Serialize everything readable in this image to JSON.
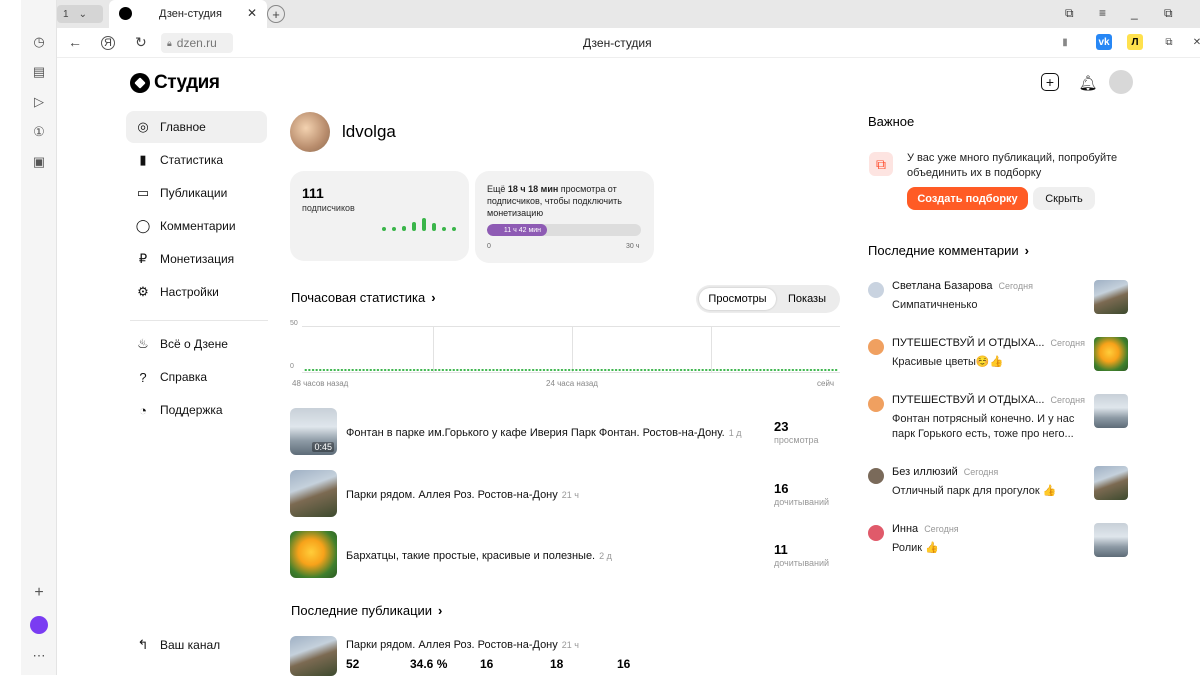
{
  "browser": {
    "tab_counter": "1",
    "tab_title": "Дзен-студия",
    "url": "dzen.ru",
    "page_title": "Дзен-студия"
  },
  "studio": {
    "logo": "Студия",
    "nav": [
      {
        "label": "Главное",
        "icon": "planet-icon"
      },
      {
        "label": "Статистика",
        "icon": "stats-icon"
      },
      {
        "label": "Публикации",
        "icon": "publications-icon"
      },
      {
        "label": "Комментарии",
        "icon": "comment-icon"
      },
      {
        "label": "Монетизация",
        "icon": "ruble-icon"
      },
      {
        "label": "Настройки",
        "icon": "gear-icon"
      }
    ],
    "nav_secondary": [
      {
        "label": "Всё о Дзене",
        "icon": "flame-icon"
      },
      {
        "label": "Справка",
        "icon": "help-icon"
      },
      {
        "label": "Поддержка",
        "icon": "support-icon"
      }
    ],
    "your_channel": "Ваш канал"
  },
  "profile": {
    "name": "ldvolga",
    "subscribers_count": "111",
    "subscribers_label": "подписчиков"
  },
  "monetization": {
    "text_pre": "Ещё ",
    "text_bold": "18 ч 18 мин",
    "text_post": " просмотра от подписчиков, чтобы подключить монетизацию",
    "progress_label": "11 ч 42 мин",
    "progress_fraction": 0.39,
    "min": "0",
    "max": "30 ч"
  },
  "hourly": {
    "title": "Почасовая статистика",
    "tabs": [
      "Просмотры",
      "Показы"
    ],
    "active_tab": 0,
    "y_max": "50",
    "y_min": "0",
    "x_labels": [
      "48 часов назад",
      "24 часа назад",
      "сейч"
    ]
  },
  "chart_data": {
    "type": "bar",
    "title": "Почасовая статистика",
    "ylim": [
      0,
      50
    ],
    "values": [
      1,
      1,
      1,
      1,
      1,
      1,
      1,
      1,
      1,
      1,
      1,
      1,
      1,
      1,
      1,
      1,
      1,
      1,
      1,
      1,
      1,
      1,
      1,
      1,
      1,
      1,
      1,
      1,
      1,
      1,
      1,
      1,
      1,
      1,
      1,
      1,
      1,
      1,
      1,
      1,
      1,
      1,
      1,
      1,
      1,
      1,
      1,
      1,
      1,
      1,
      1,
      1,
      1,
      1,
      1,
      1,
      1,
      1,
      1,
      1,
      1,
      1,
      1,
      1,
      1,
      1,
      1,
      1,
      1,
      1,
      1,
      1,
      1,
      1,
      1,
      1,
      1,
      1,
      1,
      1,
      1,
      1,
      1,
      1,
      1,
      1,
      1,
      1,
      1,
      1,
      1,
      1,
      1,
      1,
      1,
      1,
      1,
      1,
      1,
      1,
      1,
      1,
      1,
      1,
      1,
      1,
      1,
      1,
      1,
      1,
      1,
      1,
      1,
      1,
      1,
      1,
      1,
      1,
      1,
      1,
      1,
      1,
      1,
      1,
      1,
      1,
      1,
      1,
      1,
      1,
      1,
      1,
      1,
      1,
      1,
      1,
      1,
      1,
      1,
      1,
      1,
      1,
      1,
      1,
      1,
      1,
      1,
      1
    ]
  },
  "publications": [
    {
      "title": "Фонтан в парке им.Горького у кафе Иверия Парк Фонтан. Ростов-на-Дону.",
      "age": "1 д",
      "value": "23",
      "label": "просмотра",
      "duration": "0:45",
      "thumb": "fountain"
    },
    {
      "title": "Парки рядом. Аллея Роз. Ростов-на-Дону",
      "age": "21 ч",
      "value": "16",
      "label": "дочитываний",
      "duration": "",
      "thumb": "statue"
    },
    {
      "title": "Бархатцы, такие простые, красивые и полезные.",
      "age": "2 д",
      "value": "11",
      "label": "дочитываний",
      "duration": "",
      "thumb": "flower"
    }
  ],
  "latest": {
    "title": "Последние публикации",
    "item_title": "Парки рядом. Аллея Роз. Ростов-на-Дону",
    "item_age": "21 ч",
    "stats": [
      "52",
      "34.6 %",
      "16",
      "18",
      "16"
    ]
  },
  "important": {
    "title": "Важное",
    "text": "У вас уже много публикаций, попробуйте объединить их в подборку",
    "primary": "Создать подборку",
    "secondary": "Скрыть"
  },
  "comments": {
    "title": "Последние комментарии",
    "items": [
      {
        "author": "Светлана Базарова",
        "time": "Сегодня",
        "text": "Симпатичненько",
        "thumb": "statue"
      },
      {
        "author": "ПУТЕШЕСТВУЙ И ОТДЫХА...",
        "time": "Сегодня",
        "text": "Красивые цветы☺️👍",
        "thumb": "flower"
      },
      {
        "author": "ПУТЕШЕСТВУЙ И ОТДЫХА...",
        "time": "Сегодня",
        "text": "Фонтан потрясный конечно. И у нас парк Горького есть, тоже про него...",
        "thumb": "fountain"
      },
      {
        "author": "Без иллюзий",
        "time": "Сегодня",
        "text": "Отличный парк для прогулок 👍",
        "thumb": "statue"
      },
      {
        "author": "Инна",
        "time": "Сегодня",
        "text": "Ролик 👍",
        "thumb": "fountain"
      }
    ]
  },
  "colors": {
    "accent": "#ff5b25",
    "chart_green": "#3ab54a",
    "progress_purple": "#8e5bb4"
  }
}
